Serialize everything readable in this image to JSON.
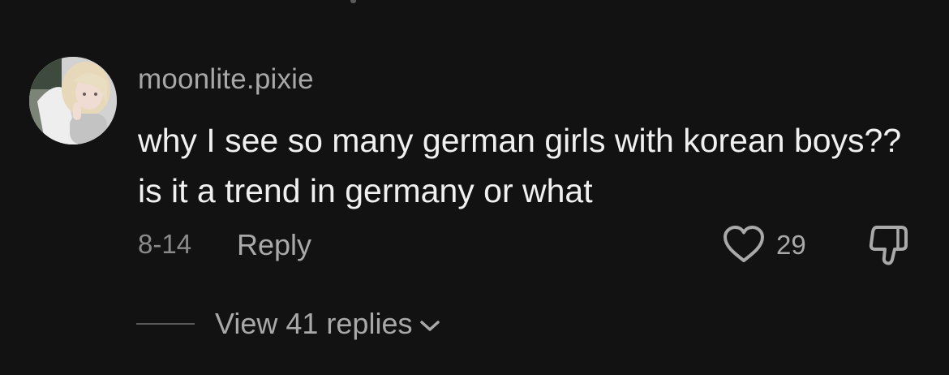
{
  "comment": {
    "username": "moonlite.pixie",
    "text": "why I see so many german girls with korean boys?? is it a trend in germany or what",
    "date": "8-14",
    "reply_label": "Reply",
    "like_count": "29",
    "liked": false
  },
  "replies": {
    "label": "View 41 replies",
    "expanded": false
  },
  "icons": {
    "like": "heart-outline-icon",
    "dislike": "thumbs-down-icon",
    "expand": "chevron-down-icon"
  },
  "colors": {
    "background": "#121212",
    "text_primary": "#f0f0f0",
    "text_secondary": "#a9a9a9"
  }
}
